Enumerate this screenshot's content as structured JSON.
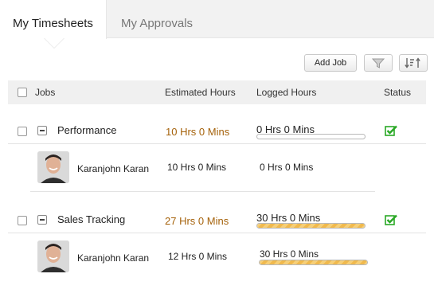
{
  "tabs": [
    {
      "label": "My Timesheets",
      "active": true
    },
    {
      "label": "My Approvals",
      "active": false
    }
  ],
  "toolbar": {
    "add_job_label": "Add Job",
    "filter_icon": "filter-icon",
    "sort_icon": "sort-icon"
  },
  "table": {
    "headers": {
      "jobs": "Jobs",
      "estimated": "Estimated Hours",
      "logged": "Logged Hours",
      "status": "Status"
    },
    "jobs": [
      {
        "name": "Performance",
        "estimated": "10 Hrs 0 Mins",
        "logged": "0 Hrs 0 Mins",
        "progress": 0,
        "status_icon": "approved-check-icon",
        "members": [
          {
            "name": "Karanjohn Karan",
            "estimated": "10 Hrs 0 Mins",
            "logged": "0 Hrs 0 Mins",
            "progress": null
          }
        ]
      },
      {
        "name": "Sales Tracking",
        "estimated": "27 Hrs 0 Mins",
        "logged": "30 Hrs 0 Mins",
        "progress": 1.0,
        "status_icon": "approved-check-icon",
        "members": [
          {
            "name": "Karanjohn Karan",
            "estimated": "12 Hrs 0 Mins",
            "logged": "30 Hrs 0 Mins",
            "progress": 1.0
          }
        ]
      }
    ]
  },
  "colors": {
    "estimated_total": "#a5620b",
    "status_check": "#2aa826",
    "progress_fill": "#f2c260"
  }
}
